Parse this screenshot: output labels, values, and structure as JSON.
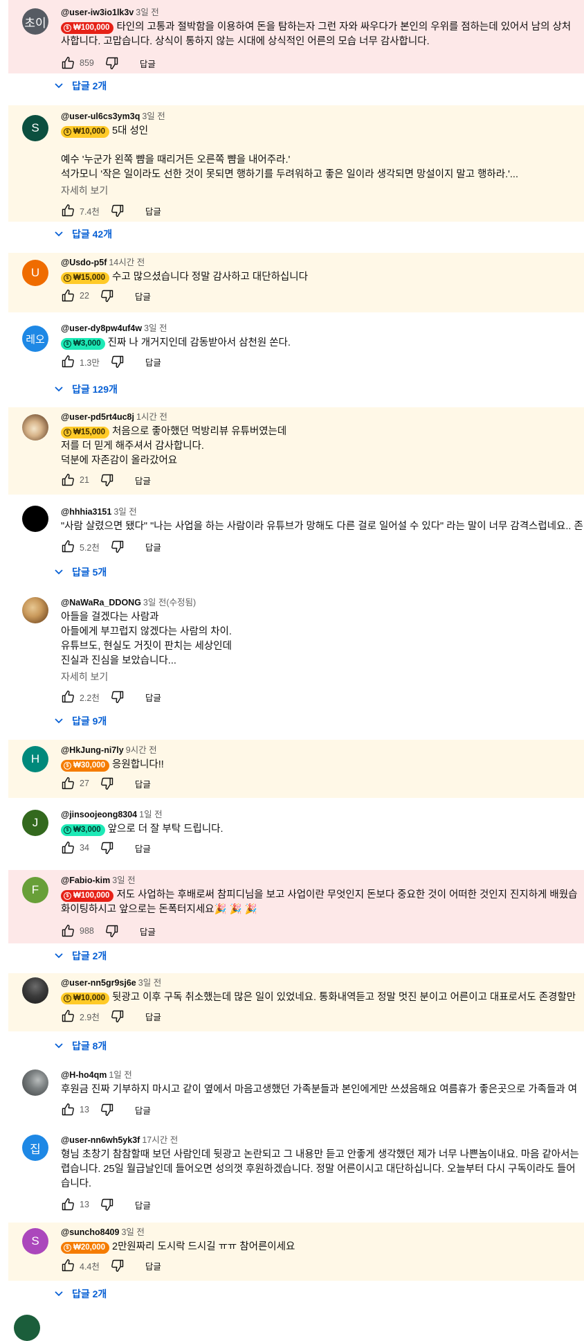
{
  "comments": [
    {
      "avatar_text": "초이",
      "avatar_color": "#565b63",
      "handle": "@user-iw3io1lk3v",
      "time": "3일 전",
      "donation": "₩100,000",
      "donation_color": "#e62117",
      "text1": "타인의 고통과 절박함을 이용하여 돈을 탐하는자 그런 자와 싸우다가 본인의 우위를 점하는데 있어서 남의 상처",
      "text2": "사합니다. 고맙습니다. 상식이 통하지 않는 시대에 상식적인 어른의 모습 너무 감사합니다.",
      "likes": "859",
      "reply_label": "답글",
      "replies": "답글 2개"
    },
    {
      "avatar_text": "S",
      "avatar_color": "#0b4f3f",
      "handle": "@user-ul6cs3ym3q",
      "time": "3일 전",
      "donation": "₩10,000",
      "donation_color": "#ffca28",
      "text1": "5대 성인",
      "text3": "예수 '누군가 왼쪽 뺨을 때리거든 오른쪽 뺨을 내어주라.'",
      "text4": "석가모니 '작은 일이라도 선한 것이 못되면 행하기를 두려워하고 좋은 일이라 생각되면 망설이지 말고 행하라.'...",
      "read_more": "자세히 보기",
      "likes": "7.4천",
      "reply_label": "답글",
      "replies": "답글 42개"
    },
    {
      "avatar_text": "U",
      "avatar_color": "#ef6c00",
      "handle": "@Usdo-p5f",
      "time": "14시간 전",
      "donation": "₩15,000",
      "donation_color": "#ffca28",
      "text1": "수고 많으셨습니다 정말 감사하고 대단하십니다",
      "likes": "22",
      "reply_label": "답글"
    },
    {
      "avatar_text": "레오",
      "avatar_color": "#1e88e5",
      "handle": "@user-dy8pw4uf4w",
      "time": "3일 전",
      "donation": "₩3,000",
      "donation_color": "#1de9b6",
      "text1": "진짜 나 개거지인데 감동받아서 삼천원 쏜다.",
      "likes": "1.3만",
      "reply_label": "답글",
      "replies": "답글 129개"
    },
    {
      "avatar_text": "",
      "avatar_color": "#c9a88a",
      "handle": "@user-pd5rt4uc8j",
      "time": "1시간 전",
      "donation": "₩15,000",
      "donation_color": "#ffca28",
      "text1": "처음으로 좋아했던 먹방리뷰 유튜버였는데",
      "text2": "저를 더 믿게 해주셔서 감사합니다.",
      "text3": "덕분에 자존감이 올라갔어요",
      "likes": "21",
      "reply_label": "답글"
    },
    {
      "avatar_text": "",
      "avatar_color": "#000000",
      "handle": "@hhhia3151",
      "time": "3일 전",
      "text1": "\"사람 살렸으면 됐다\" \"나는 사업을 하는 사람이라 유튜브가 망해도 다른 걸로 일어설 수 있다\" 라는 말이 너무 감격스럽네요.. 존",
      "likes": "5.2천",
      "reply_label": "답글",
      "replies": "답글 5개"
    },
    {
      "avatar_text": "",
      "avatar_color": "#b98a52",
      "handle": "@NaWaRa_DDONG",
      "time": "3일 전(수정됨)",
      "text1": "아들을 걸겠다는 사람과",
      "text2": "아들에게 부끄럽지 않겠다는 사람의 차이.",
      "text3": "유튜브도, 현실도 거짓이 판치는 세상인데",
      "text4": "진실과 진심을 보았습니다...",
      "read_more": "자세히 보기",
      "likes": "2.2천",
      "reply_label": "답글",
      "replies": "답글 9개"
    },
    {
      "avatar_text": "H",
      "avatar_color": "#00897b",
      "handle": "@HkJung-ni7ly",
      "time": "9시간 전",
      "donation": "₩30,000",
      "donation_color": "#f57c00",
      "text1": "응원합니다!!",
      "likes": "27",
      "reply_label": "답글"
    },
    {
      "avatar_text": "J",
      "avatar_color": "#33691e",
      "handle": "@jinsoojeong8304",
      "time": "1일 전",
      "donation": "₩3,000",
      "donation_color": "#1de9b6",
      "text1": "앞으로 더 잘 부탁 드립니다.",
      "likes": "34",
      "reply_label": "답글"
    },
    {
      "avatar_text": "F",
      "avatar_color": "#689f38",
      "handle": "@Fabio-kim",
      "time": "3일 전",
      "donation": "₩100,000",
      "donation_color": "#e62117",
      "text1": "저도 사업하는 후배로써 참피디님을 보고 사업이란 무엇인지 돈보다 중요한 것이 어떠한 것인지 진지하게 배웠습",
      "text2": "화이팅하시고 앞으로는 돈폭터지세요🎉 🎉 🎉",
      "likes": "988",
      "reply_label": "답글",
      "replies": "답글 2개"
    },
    {
      "avatar_text": "",
      "avatar_color": "#3b3b3b",
      "handle": "@user-nn5gr9sj6e",
      "time": "3일 전",
      "donation": "₩10,000",
      "donation_color": "#ffca28",
      "text1": "뒷광고 이후 구독 취소했는데 많은 일이 있었네요. 통화내역듣고 정말 멋진 분이고 어른이고 대표로서도 존경할만",
      "likes": "2.9천",
      "reply_label": "답글",
      "replies": "답글 8개"
    },
    {
      "avatar_text": "",
      "avatar_color": "#7a7f80",
      "handle": "@H-ho4qm",
      "time": "1일 전",
      "text1": "후원금 진짜 기부하지 마시고 같이 옆에서 마음고생했던 가족분들과 본인에게만 쓰셨음해요 여름휴가 좋은곳으로 가족들과 여",
      "likes": "13",
      "reply_label": "답글"
    },
    {
      "avatar_text": "집",
      "avatar_color": "#1e88e5",
      "handle": "@user-nn6wh5yk3f",
      "time": "17시간 전",
      "text1": "형님 초창기 참참할때 보던 사람인데 뒷광고 논란되고 그 내용만 듣고 안좋게 생각했던 제가 너무 나쁜놈이내요. 마음 같아서는",
      "text2": "렵습니다. 25일 월급날인데 들어오면 성의껏 후원하겠습니다. 정말 어른이시고 대단하십니다. 오늘부터 다시 구독이라도 들어",
      "text3": "습니다.",
      "likes": "13",
      "reply_label": "답글"
    },
    {
      "avatar_text": "S",
      "avatar_color": "#ab47bc",
      "handle": "@suncho8409",
      "time": "3일 전",
      "donation": "₩20,000",
      "donation_color": "#f57c00",
      "text1": "2만원짜리 도시락 드시길 ㅠㅠ 참어른이세요",
      "likes": "4.4천",
      "reply_label": "답글",
      "replies": "답글 2개"
    }
  ]
}
